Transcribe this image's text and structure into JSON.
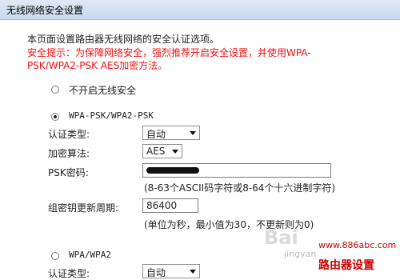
{
  "window": {
    "title": "无线网络安全设置"
  },
  "intro": {
    "line1": "本页面设置路由器无线网络的安全认证选项。",
    "warning_line1": "安全提示：为保障网络安全，强烈推荐开启安全设置，并使用WPA-",
    "warning_line2": "PSK/WPA2-PSK AES加密方法。"
  },
  "options": {
    "disable_label": "不开启无线安全",
    "wpa_psk_label": "WPA-PSK/WPA2-PSK",
    "wpa_label": "WPA/WPA2",
    "selected": "wpa_psk"
  },
  "wpa_psk": {
    "auth_type_label": "认证类型:",
    "auth_type_value": "自动",
    "encryption_label": "加密算法:",
    "encryption_value": "AES",
    "psk_label": "PSK密码:",
    "psk_hint": "(8-63个ASCII码字符或8-64个十六进制字符)",
    "rekey_label": "组密钥更新周期:",
    "rekey_value": "86400",
    "rekey_hint": "(单位为秒，最小值为30，不更新则为0)"
  },
  "wpa": {
    "auth_type_label": "认证类型:",
    "auth_type_value": "自动"
  },
  "watermarks": {
    "baidu": "Bai",
    "jingyan": "jingyan",
    "site_url": "www.886abc.com",
    "site_name": "路由器设置"
  }
}
